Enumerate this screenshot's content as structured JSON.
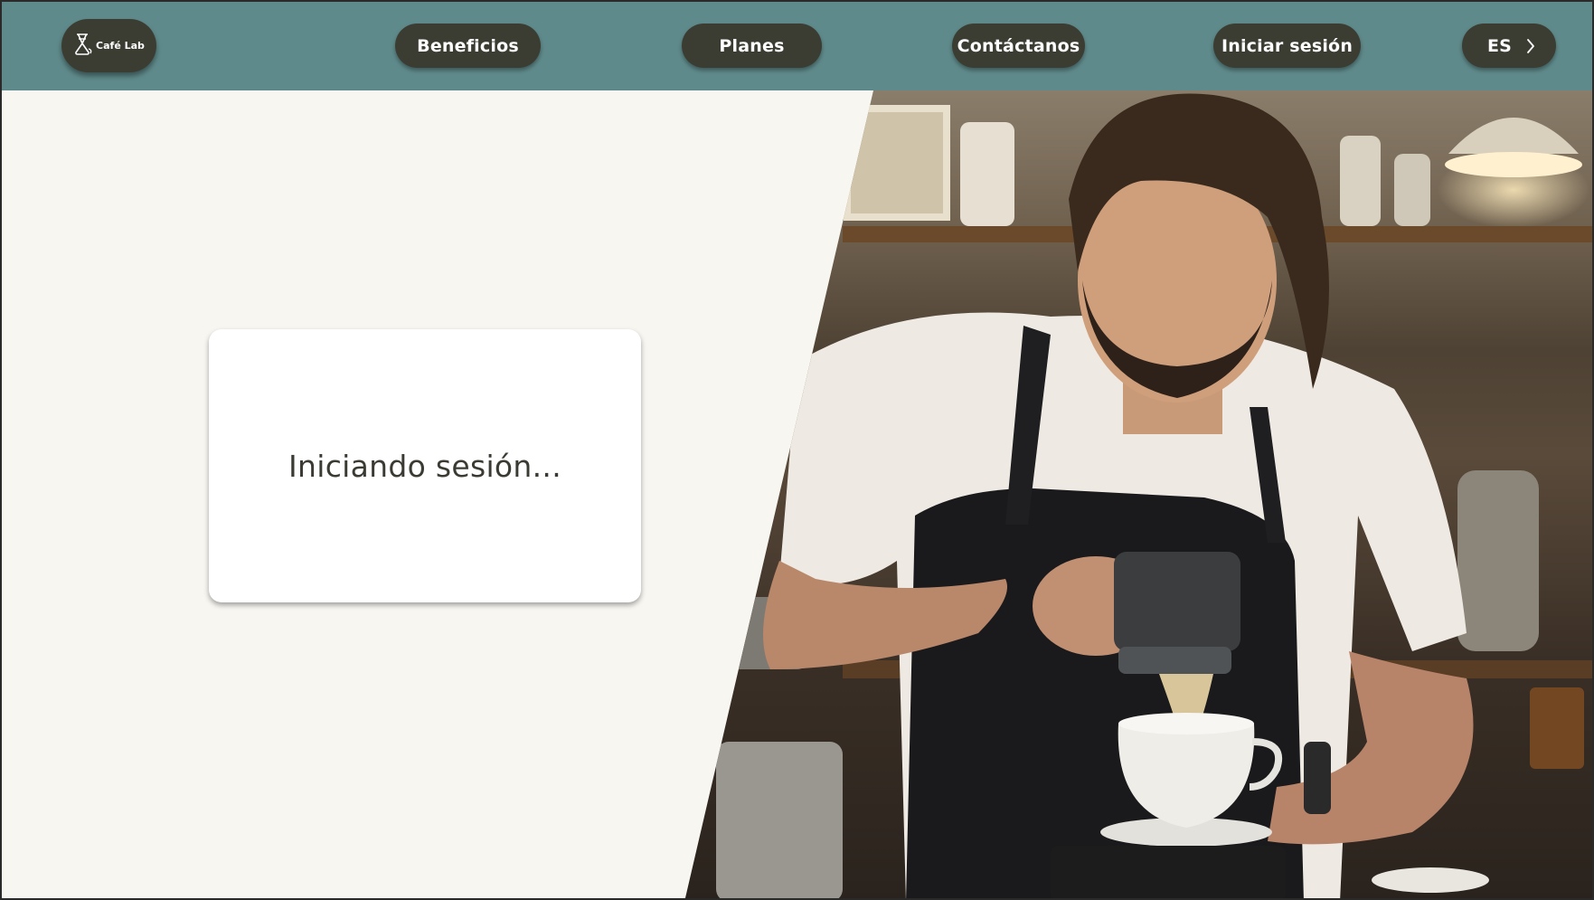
{
  "header": {
    "logo": {
      "text": "Café Lab",
      "icon": "chemex-coffee-icon"
    },
    "nav": [
      {
        "id": "beneficios",
        "label": "Beneficios"
      },
      {
        "id": "planes",
        "label": "Planes"
      },
      {
        "id": "contactanos",
        "label": "Contáctanos"
      },
      {
        "id": "login",
        "label": "Iniciar sesión"
      }
    ],
    "language": {
      "label": "ES",
      "icon": "chevron-right-icon"
    }
  },
  "main": {
    "status_text": "Iniciando sesión...",
    "hero_image": "barista-pouring-espresso-photo"
  },
  "colors": {
    "header_bg": "#5f8a8b",
    "pill_bg": "#3c3d32",
    "page_bg": "#f8f6f1",
    "card_bg": "#ffffff",
    "text_dark": "#3b3b33"
  }
}
